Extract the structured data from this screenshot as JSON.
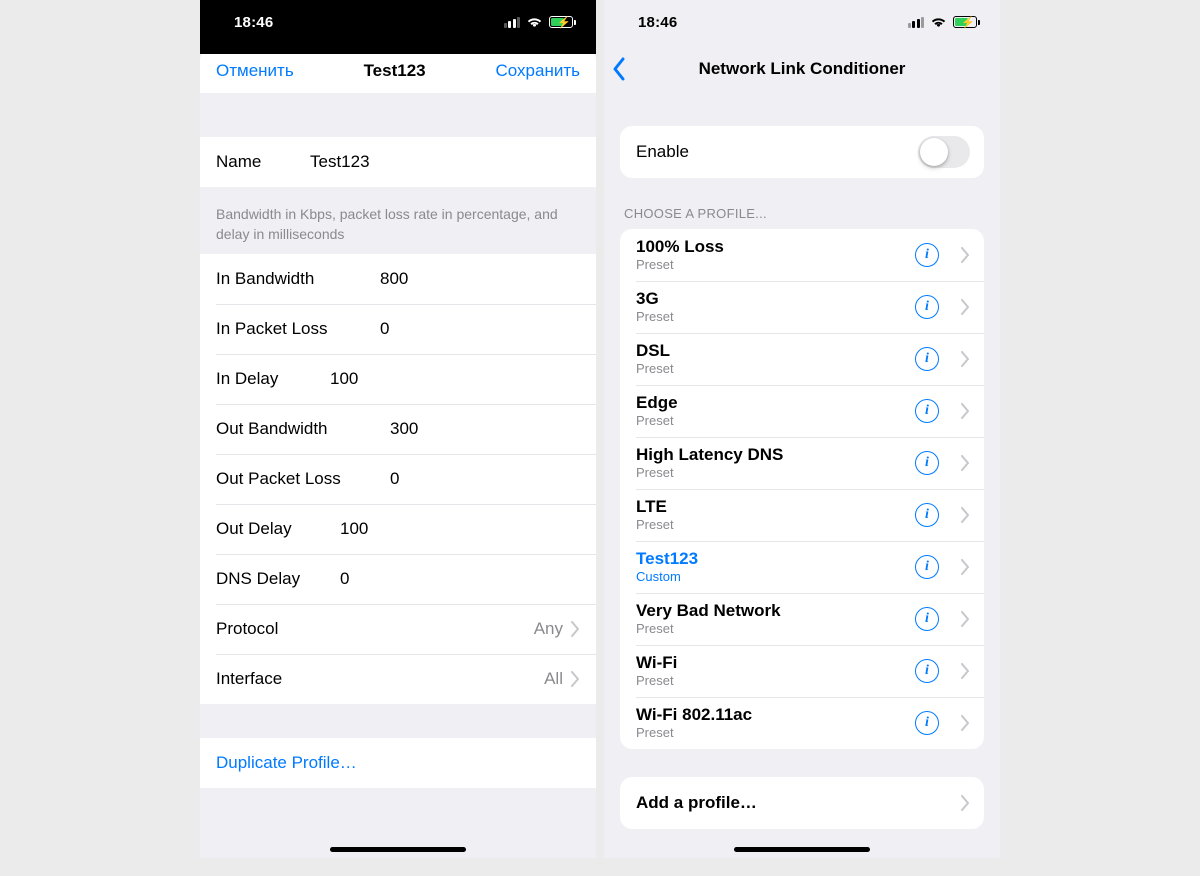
{
  "status": {
    "time": "18:46"
  },
  "left": {
    "nav": {
      "cancel": "Отменить",
      "title": "Test123",
      "save": "Сохранить"
    },
    "name_label": "Name",
    "name_value": "Test123",
    "note": "Bandwidth in Kbps, packet loss rate in percentage, and delay in milliseconds",
    "fields": {
      "in_bandwidth_label": "In Bandwidth",
      "in_bandwidth": "800",
      "in_packet_loss_label": "In Packet Loss",
      "in_packet_loss": "0",
      "in_delay_label": "In Delay",
      "in_delay": "100",
      "out_bandwidth_label": "Out Bandwidth",
      "out_bandwidth": "300",
      "out_packet_loss_label": "Out Packet Loss",
      "out_packet_loss": "0",
      "out_delay_label": "Out Delay",
      "out_delay": "100",
      "dns_delay_label": "DNS Delay",
      "dns_delay": "0",
      "protocol_label": "Protocol",
      "protocol": "Any",
      "interface_label": "Interface",
      "interface": "All"
    },
    "duplicate": "Duplicate Profile…"
  },
  "right": {
    "title": "Network Link Conditioner",
    "enable_label": "Enable",
    "choose_header": "CHOOSE A PROFILE...",
    "preset_label": "Preset",
    "custom_label": "Custom",
    "profiles": [
      {
        "name": "100% Loss",
        "sub": "Preset",
        "selected": false
      },
      {
        "name": "3G",
        "sub": "Preset",
        "selected": false
      },
      {
        "name": "DSL",
        "sub": "Preset",
        "selected": false
      },
      {
        "name": "Edge",
        "sub": "Preset",
        "selected": false
      },
      {
        "name": "High Latency DNS",
        "sub": "Preset",
        "selected": false
      },
      {
        "name": "LTE",
        "sub": "Preset",
        "selected": false
      },
      {
        "name": "Test123",
        "sub": "Custom",
        "selected": true
      },
      {
        "name": "Very Bad Network",
        "sub": "Preset",
        "selected": false
      },
      {
        "name": "Wi-Fi",
        "sub": "Preset",
        "selected": false
      },
      {
        "name": "Wi-Fi 802.11ac",
        "sub": "Preset",
        "selected": false
      }
    ],
    "add_profile": "Add a profile…"
  }
}
